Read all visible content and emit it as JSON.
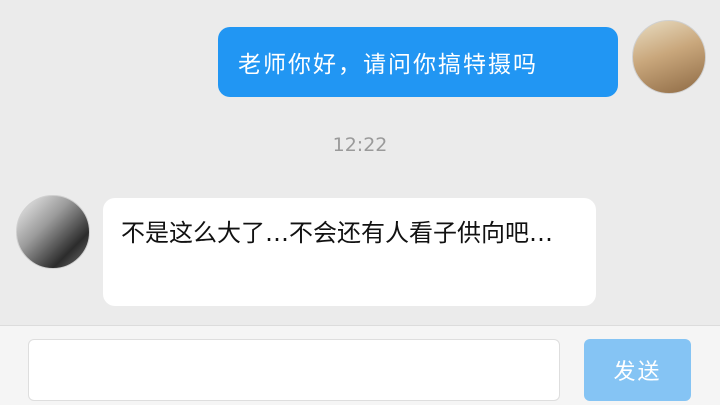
{
  "messages": {
    "outgoing": {
      "text": "老师你好，请问你搞特摄吗",
      "avatar_icon": "user-avatar-anime-portrait",
      "bubble_color": "#2196f3"
    },
    "timestamp": "12:22",
    "incoming": {
      "text": "不是这么大了…不会还有人看子供向吧…",
      "avatar_icon": "user-avatar-group-photo",
      "bubble_color": "#ffffff"
    }
  },
  "composer": {
    "value": "",
    "send_label": "发送",
    "send_color": "#85c4f4"
  }
}
